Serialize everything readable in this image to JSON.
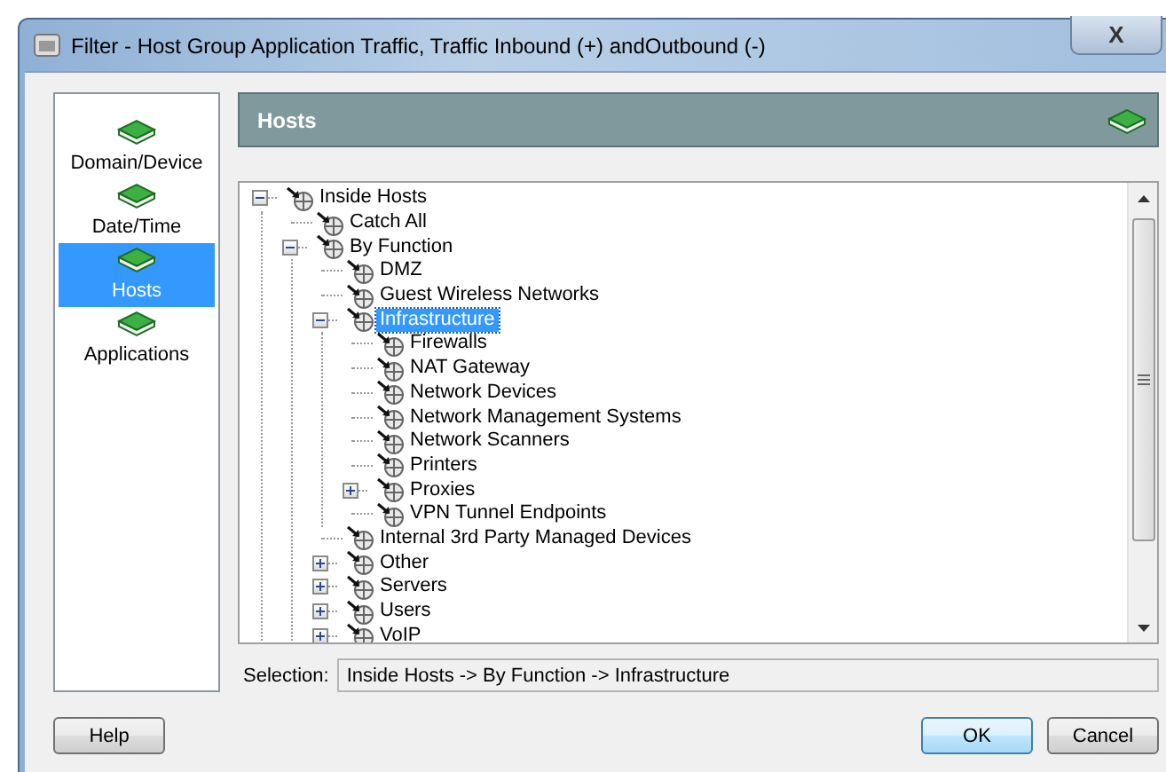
{
  "window": {
    "title": "Filter - Host Group Application Traffic, Traffic Inbound (+) andOutbound (-)",
    "close": "X"
  },
  "sidebar": {
    "items": [
      {
        "label": "Domain/Device",
        "selected": false
      },
      {
        "label": "Date/Time",
        "selected": false
      },
      {
        "label": "Hosts",
        "selected": true
      },
      {
        "label": "Applications",
        "selected": false
      }
    ]
  },
  "panel": {
    "title": "Hosts"
  },
  "tree": [
    {
      "label": "Inside Hosts",
      "expanded": true,
      "selected": false,
      "children": [
        {
          "label": "Catch All",
          "selected": false
        },
        {
          "label": "By Function",
          "expanded": true,
          "selected": false,
          "children": [
            {
              "label": "DMZ",
              "selected": false
            },
            {
              "label": "Guest Wireless Networks",
              "selected": false
            },
            {
              "label": "Infrastructure",
              "expanded": true,
              "selected": true,
              "children": [
                {
                  "label": "Firewalls",
                  "selected": false
                },
                {
                  "label": "NAT Gateway",
                  "selected": false
                },
                {
                  "label": "Network Devices",
                  "selected": false
                },
                {
                  "label": "Network Management Systems",
                  "selected": false
                },
                {
                  "label": "Network Scanners",
                  "selected": false
                },
                {
                  "label": "Printers",
                  "selected": false
                },
                {
                  "label": "Proxies",
                  "expanded": false,
                  "selected": false
                },
                {
                  "label": "VPN Tunnel Endpoints",
                  "selected": false
                }
              ]
            },
            {
              "label": "Internal 3rd Party Managed Devices",
              "selected": false
            },
            {
              "label": "Other",
              "expanded": false,
              "selected": false
            },
            {
              "label": "Servers",
              "expanded": false,
              "selected": false
            },
            {
              "label": "Users",
              "expanded": false,
              "selected": false
            },
            {
              "label": "VoIP",
              "expanded": false,
              "selected": false
            }
          ]
        }
      ]
    }
  ],
  "selection": {
    "label": "Selection:",
    "value": "Inside Hosts -> By Function -> Infrastructure"
  },
  "buttons": [
    {
      "label": "Help",
      "kind": "secondary"
    },
    {
      "label": "OK",
      "kind": "default"
    },
    {
      "label": "Cancel",
      "kind": "secondary"
    }
  ]
}
